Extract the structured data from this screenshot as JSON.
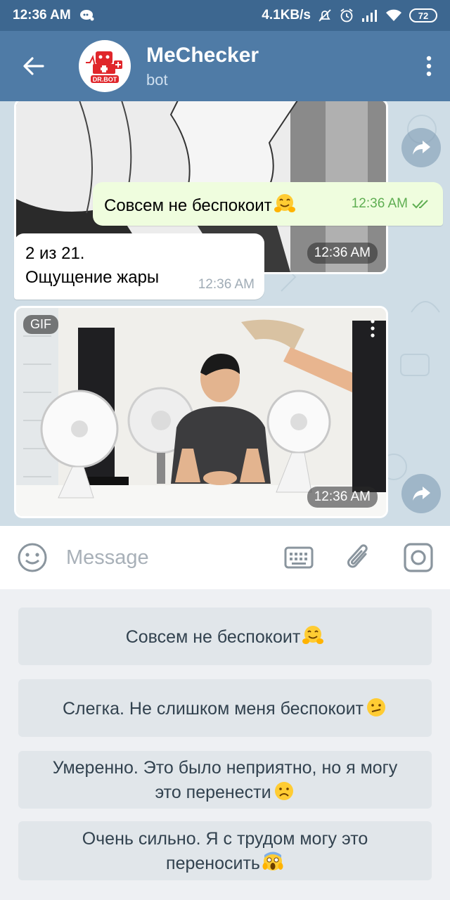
{
  "status_bar": {
    "time": "12:36 AM",
    "speed": "4.1KB/s",
    "battery": "72",
    "icons": [
      "notification-bubble-icon",
      "mute-bell-icon",
      "alarm-icon",
      "signal-icon",
      "wifi-icon",
      "battery-icon"
    ]
  },
  "header": {
    "title": "MeChecker",
    "subtitle": "bot",
    "avatar_text": "DR.BOT"
  },
  "messages": {
    "top_media": {
      "time": "12:36 AM"
    },
    "outgoing": {
      "text": "Совсем не беспокоит",
      "time": "12:36 AM"
    },
    "incoming": {
      "line1": "2 из 21.",
      "line2": "Ощущение жары",
      "time": "12:36 AM"
    },
    "gif": {
      "badge": "GIF",
      "time": "12:36 AM"
    }
  },
  "input_bar": {
    "placeholder": "Message"
  },
  "keyboard": {
    "buttons": [
      {
        "label": "Совсем не беспокоит",
        "emoji": "hugging"
      },
      {
        "label": "Слегка. Не слишком меня беспокоит",
        "emoji": "confused"
      },
      {
        "label_line1": "Умеренно. Это было неприятно, но я могу",
        "label_line2": "это перенести",
        "emoji": "frowning"
      },
      {
        "label_line1": "Очень сильно. Я с трудом могу это",
        "label_line2": "переносить",
        "emoji": "screaming"
      }
    ]
  },
  "colors": {
    "status_bar": "#3d6790",
    "header": "#4f7ba6",
    "chat_bg": "#cfdde6",
    "outgoing_bubble": "#effdde",
    "check_green": "#5fae52",
    "keyboard_button": "#e1e6ea"
  }
}
